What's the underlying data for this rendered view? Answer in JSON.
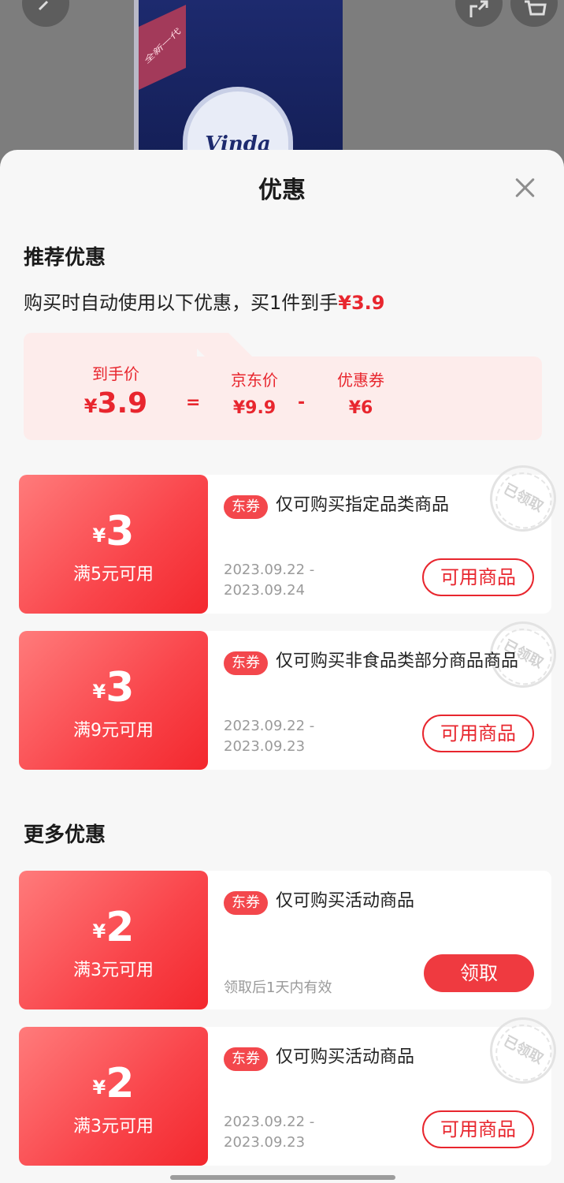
{
  "product_image": {
    "brand_logo": "Vinda",
    "badge": "全新一代"
  },
  "icons": {
    "back": "chevron-left-icon",
    "share": "share-icon",
    "cart": "cart-icon",
    "close": "close-icon"
  },
  "sheet": {
    "title": "优惠"
  },
  "recommended": {
    "section_title": "推荐优惠",
    "auto_text": "购买时自动使用以下优惠，买1件到手",
    "auto_price": "¥3.9",
    "breakdown": {
      "final_label": "到手价",
      "final_yen": "¥",
      "final_value": "3.9",
      "equals": "=",
      "jd_label": "京东价",
      "jd_value": "¥9.9",
      "minus": "-",
      "coupon_label": "优惠券",
      "coupon_value": "¥6"
    }
  },
  "coupons_recommended": [
    {
      "yen": "¥",
      "amount": "3",
      "condition": "满5元可用",
      "tag": "东券",
      "description": "仅可购买指定品类商品",
      "date_start": "2023.09.22 -",
      "date_end": "2023.09.24",
      "button": "可用商品",
      "stamp": "已领取"
    },
    {
      "yen": "¥",
      "amount": "3",
      "condition": "满9元可用",
      "tag": "东券",
      "description": "仅可购买非食品类部分商品商品",
      "date_start": "2023.09.22 -",
      "date_end": "2023.09.23",
      "button": "可用商品",
      "stamp": "已领取"
    }
  ],
  "more": {
    "section_title": "更多优惠"
  },
  "coupons_more": [
    {
      "yen": "¥",
      "amount": "2",
      "condition": "满3元可用",
      "tag": "东券",
      "description": "仅可购买活动商品",
      "validity": "领取后1天内有效",
      "button": "领取"
    },
    {
      "yen": "¥",
      "amount": "2",
      "condition": "满3元可用",
      "tag": "东券",
      "description": "仅可购买活动商品",
      "date_start": "2023.09.22 -",
      "date_end": "2023.09.23",
      "button": "可用商品",
      "stamp": "已领取"
    }
  ],
  "colors": {
    "accent_red": "#e8262e",
    "coupon_gradient_start": "#ff7b7b",
    "coupon_gradient_end": "#f3282e",
    "breakdown_bg": "#fdeceb"
  }
}
